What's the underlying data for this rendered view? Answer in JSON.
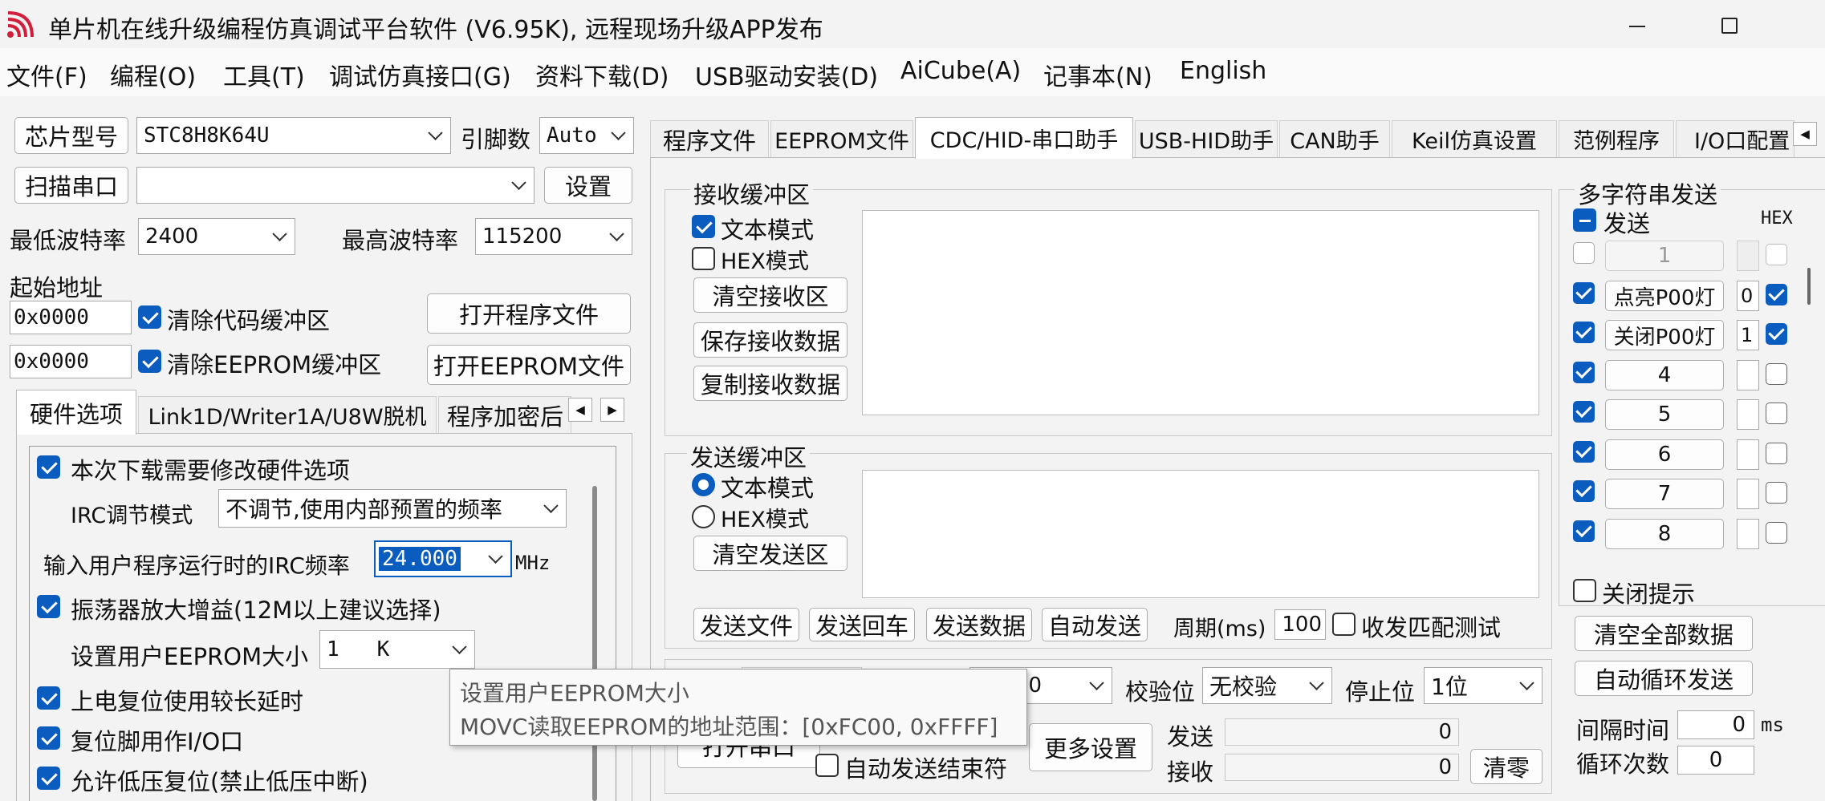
{
  "window": {
    "title": "单片机在线升级编程仿真调试平台软件 (V6.95K), 远程现场升级APP发布"
  },
  "menu": [
    "文件(F)",
    "编程(O)",
    "工具(T)",
    "调试仿真接口(G)",
    "资料下载(D)",
    "USB驱动安装(D)",
    "AiCube(A)",
    "记事本(N)",
    "English"
  ],
  "left": {
    "chip_btn": "芯片型号",
    "chip_value": "STC8H8K64U",
    "pin_label": "引脚数",
    "pin_value": "Auto",
    "scan_btn": "扫描串口",
    "port_value": "",
    "settings_btn": "设置",
    "min_baud_label": "最低波特率",
    "min_baud_value": "2400",
    "max_baud_label": "最高波特率",
    "max_baud_value": "115200",
    "start_addr_label": "起始地址",
    "addr1": "0x0000",
    "addr2": "0x0000",
    "clear_code": "清除代码缓冲区",
    "clear_eeprom": "清除EEPROM缓冲区",
    "open_prog": "打开程序文件",
    "open_eeprom": "打开EEPROM文件",
    "tabs": [
      "硬件选项",
      "Link1D/Writer1A/U8W脱机",
      "程序加密后"
    ],
    "hw": {
      "modify_opts": "本次下载需要修改硬件选项",
      "irc_mode_label": "IRC调节模式",
      "irc_mode_value": "不调节,使用内部预置的频率",
      "irc_freq_label": "输入用户程序运行时的IRC频率",
      "irc_freq_value": "24.000",
      "irc_unit": "MHz",
      "osc_gain": "振荡器放大增益(12M以上建议选择)",
      "eeprom_size_label": "设置用户EEPROM大小",
      "eeprom_size_value": "1   K",
      "power_reset": "上电复位使用较长延时",
      "reset_io": "复位脚用作I/O口",
      "low_volt": "允许低压复位(禁止低压中断)"
    },
    "tooltip": {
      "line1": "设置用户EEPROM大小",
      "line2": "MOVC读取EEPROM的地址范围：[0xFC00, 0xFFFF]"
    }
  },
  "right": {
    "tabs": [
      "程序文件",
      "EEPROM文件",
      "CDC/HID-串口助手",
      "USB-HID助手",
      "CAN助手",
      "Keil仿真设置",
      "范例程序",
      "I/O口配置"
    ],
    "recv": {
      "title": "接收缓冲区",
      "text_mode": "文本模式",
      "hex_mode": "HEX模式",
      "clear": "清空接收区",
      "save": "保存接收数据",
      "copy": "复制接收数据"
    },
    "send": {
      "title": "发送缓冲区",
      "text_mode": "文本模式",
      "hex_mode": "HEX模式",
      "clear": "清空发送区",
      "send_file": "发送文件",
      "send_cr": "发送回车",
      "send_data": "发送数据",
      "auto_send": "自动发送",
      "period_label": "周期(ms)",
      "period_value": "100",
      "match_test": "收发匹配测试"
    },
    "bottom": {
      "baud_partial": "00",
      "parity_label": "校验位",
      "parity_value": "无校验",
      "stop_label": "停止位",
      "stop_value": "1位",
      "open_port": "打开串口",
      "auto_end": "自动发送结束符",
      "more": "更多设置",
      "send_label": "发送",
      "send_count": "0",
      "recv_label": "接收",
      "recv_count": "0",
      "clear_btn": "清零"
    },
    "multi": {
      "title": "多字符串发送",
      "send_header": "发送",
      "hex_header": "HEX",
      "rows": [
        {
          "label": "1",
          "checked": false,
          "enabled": false,
          "hexval": "",
          "hex": false
        },
        {
          "label": "点亮P00灯",
          "checked": true,
          "enabled": true,
          "hexval": "0",
          "hex": true
        },
        {
          "label": "关闭P00灯",
          "checked": true,
          "enabled": true,
          "hexval": "1",
          "hex": true
        },
        {
          "label": "4",
          "checked": true,
          "enabled": true,
          "hexval": "",
          "hex": false
        },
        {
          "label": "5",
          "checked": true,
          "enabled": true,
          "hexval": "",
          "hex": false
        },
        {
          "label": "6",
          "checked": true,
          "enabled": true,
          "hexval": "",
          "hex": false
        },
        {
          "label": "7",
          "checked": true,
          "enabled": true,
          "hexval": "",
          "hex": false
        },
        {
          "label": "8",
          "checked": true,
          "enabled": true,
          "hexval": "",
          "hex": false
        }
      ],
      "close_tip": "关闭提示",
      "clear_all": "清空全部数据",
      "auto_loop": "自动循环发送",
      "interval_label": "间隔时间",
      "interval_value": "0",
      "interval_unit": "ms",
      "loop_label": "循环次数",
      "loop_value": "0"
    }
  }
}
